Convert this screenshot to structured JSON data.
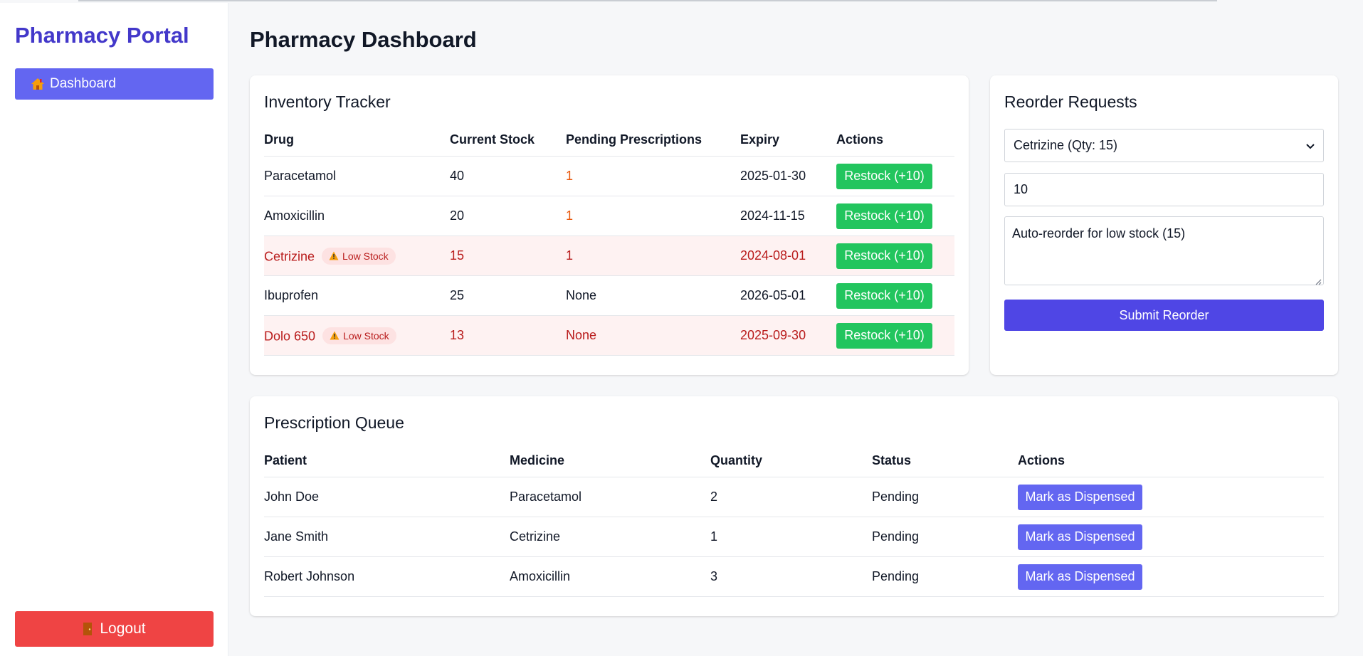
{
  "sidebar": {
    "brand": "Pharmacy Portal",
    "nav": [
      {
        "label": "Dashboard",
        "icon": "house-icon"
      }
    ],
    "logout_label": "Logout",
    "logout_icon": "door-icon"
  },
  "page_title": "Pharmacy Dashboard",
  "inventory": {
    "title": "Inventory Tracker",
    "headers": [
      "Drug",
      "Current Stock",
      "Pending Prescriptions",
      "Expiry",
      "Actions"
    ],
    "badge_label": "Low Stock",
    "restock_label": "Restock (+10)",
    "rows": [
      {
        "drug": "Paracetamol",
        "stock": "40",
        "pending": "1",
        "expiry": "2025-01-30",
        "low": false
      },
      {
        "drug": "Amoxicillin",
        "stock": "20",
        "pending": "1",
        "expiry": "2024-11-15",
        "low": false
      },
      {
        "drug": "Cetrizine",
        "stock": "15",
        "pending": "1",
        "expiry": "2024-08-01",
        "low": true
      },
      {
        "drug": "Ibuprofen",
        "stock": "25",
        "pending": "None",
        "expiry": "2026-05-01",
        "low": false
      },
      {
        "drug": "Dolo 650",
        "stock": "13",
        "pending": "None",
        "expiry": "2025-09-30",
        "low": true
      }
    ]
  },
  "reorder": {
    "title": "Reorder Requests",
    "selected_drug": "Cetrizine (Qty: 15)",
    "quantity": "10",
    "note": "Auto-reorder for low stock (15)",
    "submit_label": "Submit Reorder"
  },
  "queue": {
    "title": "Prescription Queue",
    "headers": [
      "Patient",
      "Medicine",
      "Quantity",
      "Status",
      "Actions"
    ],
    "action_label": "Mark as Dispensed",
    "rows": [
      {
        "patient": "John Doe",
        "medicine": "Paracetamol",
        "quantity": "2",
        "status": "Pending"
      },
      {
        "patient": "Jane Smith",
        "medicine": "Cetrizine",
        "quantity": "1",
        "status": "Pending"
      },
      {
        "patient": "Robert Johnson",
        "medicine": "Amoxicillin",
        "quantity": "3",
        "status": "Pending"
      }
    ]
  },
  "colors": {
    "brand": "#4338ca",
    "nav_active": "#6366f1",
    "logout": "#ef4444",
    "restock": "#22c55e",
    "dispense": "#6366f1",
    "submit": "#4f46e5",
    "low_stock_row": "#fef2f2",
    "low_stock_text": "#b91c1c",
    "pending_count": "#ea580c"
  }
}
